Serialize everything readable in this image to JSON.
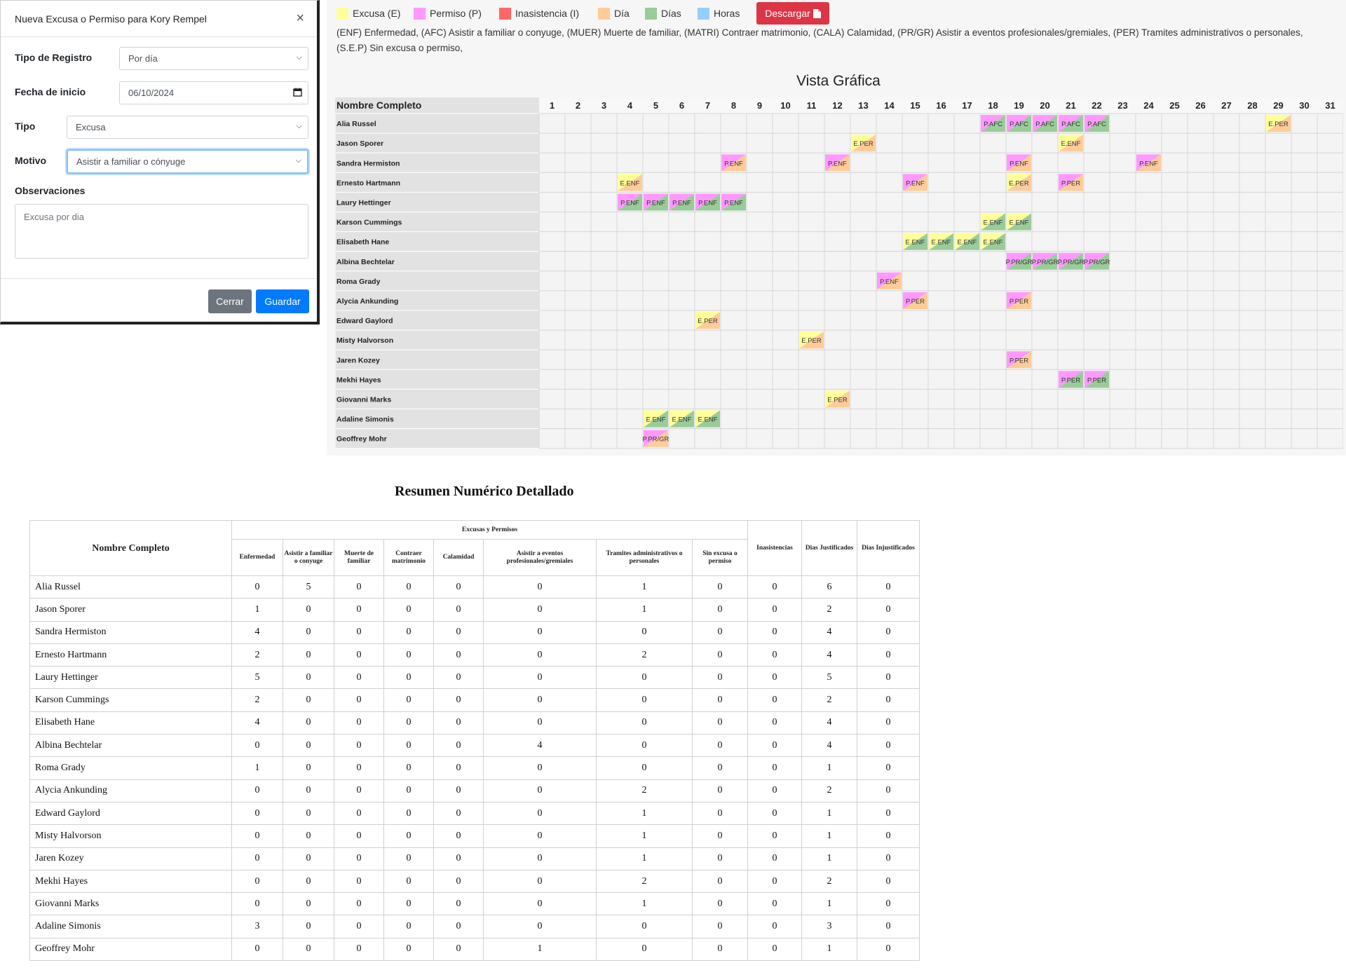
{
  "modal": {
    "title": "Nueva Excusa o Permiso para Kory Rempel",
    "close_icon": "×",
    "fields": {
      "tipo_registro": {
        "label": "Tipo de Registro",
        "value": "Por día"
      },
      "fecha_inicio": {
        "label": "Fecha de inicio",
        "value": "06/10/2024"
      },
      "tipo": {
        "label": "Tipo",
        "value": "Excusa"
      },
      "motivo": {
        "label": "Motivo",
        "value": "Asistir a familiar o cónyuge"
      },
      "observaciones": {
        "label": "Observaciones",
        "value": "Excusa por dia"
      }
    },
    "buttons": {
      "close": "Cerrar",
      "save": "Guardar"
    }
  },
  "legend": [
    {
      "label": "Excusa (E)",
      "color": "#ffff99"
    },
    {
      "label": "Permiso (P)",
      "color": "#ff99ff"
    },
    {
      "label": "Inasistencia (I)",
      "color": "#ff6666"
    },
    {
      "label": "Día",
      "color": "#ffcc99"
    },
    {
      "label": "Días",
      "color": "#99cc99"
    },
    {
      "label": "Horas",
      "color": "#99ccff"
    }
  ],
  "download_button": "Descargar",
  "download_icon": "file-pdf-icon",
  "abbreviations": "(ENF) Enfermedad, (AFC) Asistir a familiar o conyuge, (MUER) Muerte de familiar, (MATRI) Contraer matrimonio, (CALA) Calamidad, (PR/GR) Asistir a eventos profesionales/gremiales, (PER) Tramites administrativos o personales, (S.E.P) Sin excusa o permiso,",
  "calendar": {
    "title": "Vista Gráfica",
    "name_header": "Nombre Completo",
    "days": [
      "1",
      "2",
      "3",
      "4",
      "5",
      "6",
      "7",
      "8",
      "9",
      "10",
      "11",
      "12",
      "13",
      "14",
      "15",
      "16",
      "17",
      "18",
      "19",
      "20",
      "21",
      "22",
      "23",
      "24",
      "25",
      "26",
      "27",
      "28",
      "29",
      "30",
      "31"
    ],
    "rows": [
      {
        "name": "Alia Russel",
        "cells": [
          [
            18,
            "P.AFC",
            "P",
            "dias"
          ],
          [
            19,
            "P.AFC",
            "P",
            "dias"
          ],
          [
            20,
            "P.AFC",
            "P",
            "dias"
          ],
          [
            21,
            "P.AFC",
            "P",
            "dias"
          ],
          [
            22,
            "P.AFC",
            "P",
            "dias"
          ],
          [
            29,
            "E.PER",
            "E",
            "dia"
          ]
        ]
      },
      {
        "name": "Jason Sporer",
        "cells": [
          [
            13,
            "E.PER",
            "E",
            "dia"
          ],
          [
            21,
            "E.ENF",
            "E",
            "dia"
          ]
        ]
      },
      {
        "name": "Sandra Hermiston",
        "cells": [
          [
            8,
            "P.ENF",
            "P",
            "dia"
          ],
          [
            12,
            "P.ENF",
            "P",
            "dia"
          ],
          [
            19,
            "P.ENF",
            "P",
            "dia"
          ],
          [
            24,
            "P.ENF",
            "P",
            "dia"
          ]
        ]
      },
      {
        "name": "Ernesto Hartmann",
        "cells": [
          [
            4,
            "E.ENF",
            "E",
            "dia"
          ],
          [
            15,
            "P.ENF",
            "P",
            "dia"
          ],
          [
            19,
            "E.PER",
            "E",
            "dia"
          ],
          [
            21,
            "P.PER",
            "P",
            "dia"
          ]
        ]
      },
      {
        "name": "Laury Hettinger",
        "cells": [
          [
            4,
            "P.ENF",
            "P",
            "dias"
          ],
          [
            5,
            "P.ENF",
            "P",
            "dias"
          ],
          [
            6,
            "P.ENF",
            "P",
            "dias"
          ],
          [
            7,
            "P.ENF",
            "P",
            "dias"
          ],
          [
            8,
            "P.ENF",
            "P",
            "dias"
          ]
        ]
      },
      {
        "name": "Karson Cummings",
        "cells": [
          [
            18,
            "E.ENF",
            "E",
            "dias"
          ],
          [
            19,
            "E.ENF",
            "E",
            "dias"
          ]
        ]
      },
      {
        "name": "Elisabeth Hane",
        "cells": [
          [
            15,
            "E.ENF",
            "E",
            "dias"
          ],
          [
            16,
            "E.ENF",
            "E",
            "dias"
          ],
          [
            17,
            "E.ENF",
            "E",
            "dias"
          ],
          [
            18,
            "E.ENF",
            "E",
            "dias"
          ]
        ]
      },
      {
        "name": "Albina Bechtelar",
        "cells": [
          [
            19,
            "P.PR/GR",
            "P",
            "dias"
          ],
          [
            20,
            "P.PR/GR",
            "P",
            "dias"
          ],
          [
            21,
            "P.PR/GR",
            "P",
            "dias"
          ],
          [
            22,
            "P.PR/GR",
            "P",
            "dias"
          ]
        ]
      },
      {
        "name": "Roma Grady",
        "cells": [
          [
            14,
            "P.ENF",
            "P",
            "dia"
          ]
        ]
      },
      {
        "name": "Alycia Ankunding",
        "cells": [
          [
            15,
            "P.PER",
            "P",
            "dia"
          ],
          [
            19,
            "P.PER",
            "P",
            "dia"
          ]
        ]
      },
      {
        "name": "Edward Gaylord",
        "cells": [
          [
            7,
            "E.PER",
            "E",
            "dia"
          ]
        ]
      },
      {
        "name": "Misty Halvorson",
        "cells": [
          [
            11,
            "E.PER",
            "E",
            "dia"
          ]
        ]
      },
      {
        "name": "Jaren Kozey",
        "cells": [
          [
            19,
            "P.PER",
            "P",
            "dia"
          ]
        ]
      },
      {
        "name": "Mekhi Hayes",
        "cells": [
          [
            21,
            "P.PER",
            "P",
            "dias"
          ],
          [
            22,
            "P.PER",
            "P",
            "dias"
          ]
        ]
      },
      {
        "name": "Giovanni Marks",
        "cells": [
          [
            12,
            "E.PER",
            "E",
            "dia"
          ]
        ]
      },
      {
        "name": "Adaline Simonis",
        "cells": [
          [
            5,
            "E.ENF",
            "E",
            "dias"
          ],
          [
            6,
            "E.ENF",
            "E",
            "dias"
          ],
          [
            7,
            "E.ENF",
            "E",
            "dias"
          ]
        ]
      },
      {
        "name": "Geoffrey Mohr",
        "cells": [
          [
            5,
            "P.PR/GR",
            "P",
            "dia"
          ]
        ]
      }
    ]
  },
  "summary": {
    "title": "Resumen Numérico Detallado",
    "name_header": "Nombre Completo",
    "group_header": "Excusas y Permisos",
    "columns": [
      "Enfermedad",
      "Asistir a familiar o conyuge",
      "Muerte de familiar",
      "Contraer matrimonio",
      "Calamidad",
      "Asistir a eventos profesionales/gremiales",
      "Tramites administrativos o personales",
      "Sin excusa o permiso"
    ],
    "extra_columns": [
      "Inasistencias",
      "Dias Justificados",
      "Dias Injustificados"
    ],
    "rows": [
      {
        "name": "Alia Russel",
        "values": [
          0,
          5,
          0,
          0,
          0,
          0,
          1,
          0,
          0,
          6,
          0
        ]
      },
      {
        "name": "Jason Sporer",
        "values": [
          1,
          0,
          0,
          0,
          0,
          0,
          1,
          0,
          0,
          2,
          0
        ]
      },
      {
        "name": "Sandra Hermiston",
        "values": [
          4,
          0,
          0,
          0,
          0,
          0,
          0,
          0,
          0,
          4,
          0
        ]
      },
      {
        "name": "Ernesto Hartmann",
        "values": [
          2,
          0,
          0,
          0,
          0,
          0,
          2,
          0,
          0,
          4,
          0
        ]
      },
      {
        "name": "Laury Hettinger",
        "values": [
          5,
          0,
          0,
          0,
          0,
          0,
          0,
          0,
          0,
          5,
          0
        ]
      },
      {
        "name": "Karson Cummings",
        "values": [
          2,
          0,
          0,
          0,
          0,
          0,
          0,
          0,
          0,
          2,
          0
        ]
      },
      {
        "name": "Elisabeth Hane",
        "values": [
          4,
          0,
          0,
          0,
          0,
          0,
          0,
          0,
          0,
          4,
          0
        ]
      },
      {
        "name": "Albina Bechtelar",
        "values": [
          0,
          0,
          0,
          0,
          0,
          4,
          0,
          0,
          0,
          4,
          0
        ]
      },
      {
        "name": "Roma Grady",
        "values": [
          1,
          0,
          0,
          0,
          0,
          0,
          0,
          0,
          0,
          1,
          0
        ]
      },
      {
        "name": "Alycia Ankunding",
        "values": [
          0,
          0,
          0,
          0,
          0,
          0,
          2,
          0,
          0,
          2,
          0
        ]
      },
      {
        "name": "Edward Gaylord",
        "values": [
          0,
          0,
          0,
          0,
          0,
          0,
          1,
          0,
          0,
          1,
          0
        ]
      },
      {
        "name": "Misty Halvorson",
        "values": [
          0,
          0,
          0,
          0,
          0,
          0,
          1,
          0,
          0,
          1,
          0
        ]
      },
      {
        "name": "Jaren Kozey",
        "values": [
          0,
          0,
          0,
          0,
          0,
          0,
          1,
          0,
          0,
          1,
          0
        ]
      },
      {
        "name": "Mekhi Hayes",
        "values": [
          0,
          0,
          0,
          0,
          0,
          0,
          2,
          0,
          0,
          2,
          0
        ]
      },
      {
        "name": "Giovanni Marks",
        "values": [
          0,
          0,
          0,
          0,
          0,
          0,
          1,
          0,
          0,
          1,
          0
        ]
      },
      {
        "name": "Adaline Simonis",
        "values": [
          3,
          0,
          0,
          0,
          0,
          0,
          0,
          0,
          0,
          3,
          0
        ]
      },
      {
        "name": "Geoffrey Mohr",
        "values": [
          0,
          0,
          0,
          0,
          0,
          1,
          0,
          0,
          0,
          1,
          0
        ]
      }
    ]
  }
}
